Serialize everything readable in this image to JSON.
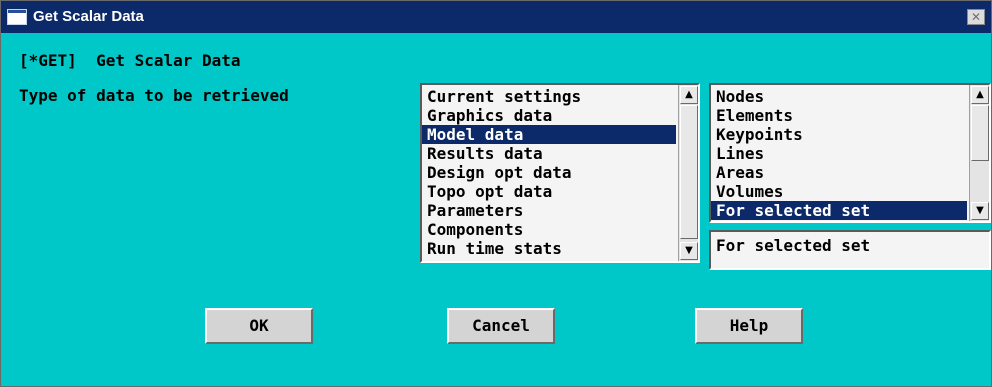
{
  "window": {
    "title": "Get Scalar Data",
    "close_glyph": "✕"
  },
  "command": "[*GET]  Get Scalar Data",
  "prompt": "Type of data to be retrieved",
  "data_type_list": {
    "items": [
      {
        "label": "Current settings",
        "selected": false
      },
      {
        "label": "Graphics data",
        "selected": false
      },
      {
        "label": "Model data",
        "selected": true
      },
      {
        "label": "Results data",
        "selected": false
      },
      {
        "label": "Design opt data",
        "selected": false
      },
      {
        "label": "Topo opt data",
        "selected": false
      },
      {
        "label": "Parameters",
        "selected": false
      },
      {
        "label": "Components",
        "selected": false
      },
      {
        "label": "Run time stats",
        "selected": false
      }
    ]
  },
  "entity_list": {
    "items": [
      {
        "label": "Nodes",
        "selected": false
      },
      {
        "label": "Elements",
        "selected": false
      },
      {
        "label": "Keypoints",
        "selected": false
      },
      {
        "label": "Lines",
        "selected": false
      },
      {
        "label": "Areas",
        "selected": false
      },
      {
        "label": "Volumes",
        "selected": false
      },
      {
        "label": "For selected set",
        "selected": true
      }
    ]
  },
  "selection_field": {
    "value": "For selected set"
  },
  "buttons": {
    "ok": "OK",
    "cancel": "Cancel",
    "help": "Help"
  },
  "icons": {
    "scroll_up": "▲",
    "scroll_down": "▼"
  }
}
